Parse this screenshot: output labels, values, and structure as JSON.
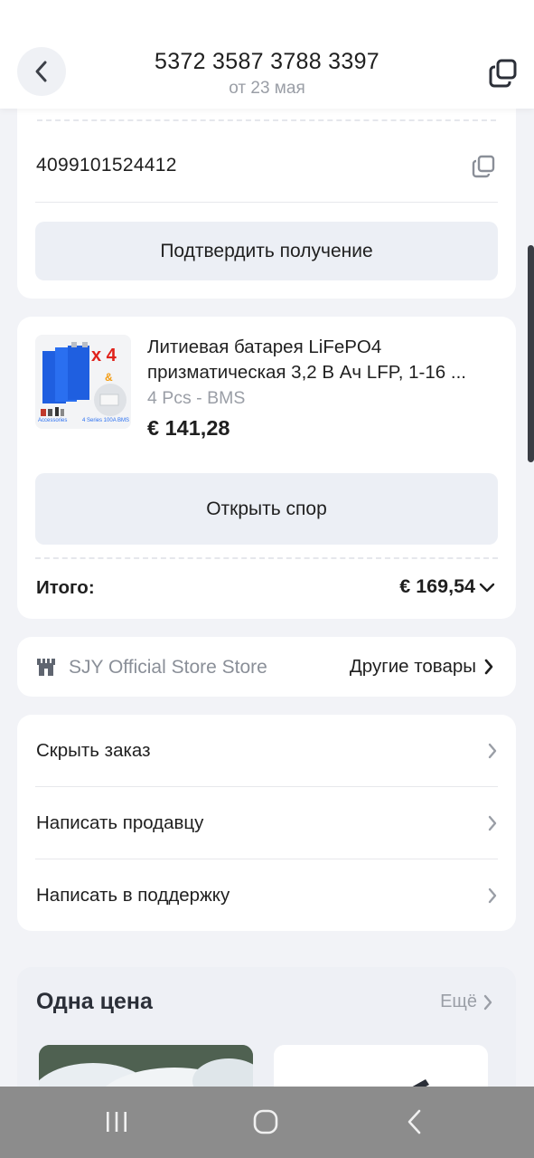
{
  "header": {
    "order_number": "5372 3587 3788 3397",
    "date": "от 23 мая"
  },
  "tracking": {
    "number": "4099101524412",
    "confirm_label": "Подтвердить получение"
  },
  "product": {
    "title_line1": "Литиевая батарея LiFePO4",
    "title_line2": "призматическая 3,2 В Ач LFP, 1-16 ...",
    "variant": "4 Pcs - BMS",
    "price": "€ 141,28",
    "thumb_badge": "x 4",
    "thumb_amp": "&",
    "thumb_caption_left": "Accessories",
    "thumb_caption_right": "4 Series 100A BMS",
    "dispute_label": "Открыть спор",
    "total_label": "Итого:",
    "total_value": "€ 169,54"
  },
  "store": {
    "name": "SJY Official Store Store",
    "more_label": "Другие товары"
  },
  "actions": [
    {
      "label": "Скрыть заказ"
    },
    {
      "label": "Написать продавцу"
    },
    {
      "label": "Написать в поддержку"
    }
  ],
  "recommendations": {
    "title": "Одна цена",
    "more_label": "Ещё"
  },
  "colors": {
    "background": "#f2f3f7",
    "card": "#ffffff",
    "button_grey": "#eceff5",
    "muted_text": "#9a9ea6",
    "nav_bar": "#8c8c8c",
    "battery_blue": "#1f5fe0",
    "badge_red": "#e0221b"
  },
  "icons": {
    "back": "chevron-left-icon",
    "copy": "copy-icon",
    "chevron": "chevron-right-icon",
    "expand": "chevron-down-icon",
    "store": "store-icon",
    "nav_recent": "recent-apps-icon",
    "nav_home": "home-icon",
    "nav_back": "back-icon"
  }
}
